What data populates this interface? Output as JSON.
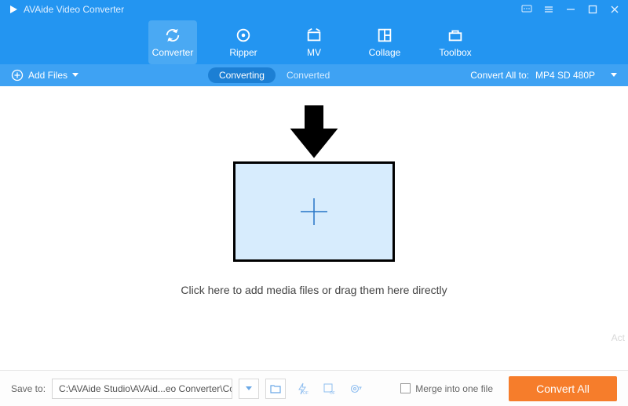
{
  "title": "AVAide Video Converter",
  "tabs": {
    "converter": "Converter",
    "ripper": "Ripper",
    "mv": "MV",
    "collage": "Collage",
    "toolbox": "Toolbox"
  },
  "subbar": {
    "add_files": "Add Files",
    "converting": "Converting",
    "converted": "Converted",
    "convert_all_to": "Convert All to:",
    "format": "MP4 SD 480P"
  },
  "main": {
    "drop_text": "Click here to add media files or drag them here directly"
  },
  "footer": {
    "save_to": "Save to:",
    "path": "C:\\AVAide Studio\\AVAid...eo Converter\\Converted",
    "merge": "Merge into one file",
    "convert_all": "Convert All",
    "act": "Act"
  }
}
